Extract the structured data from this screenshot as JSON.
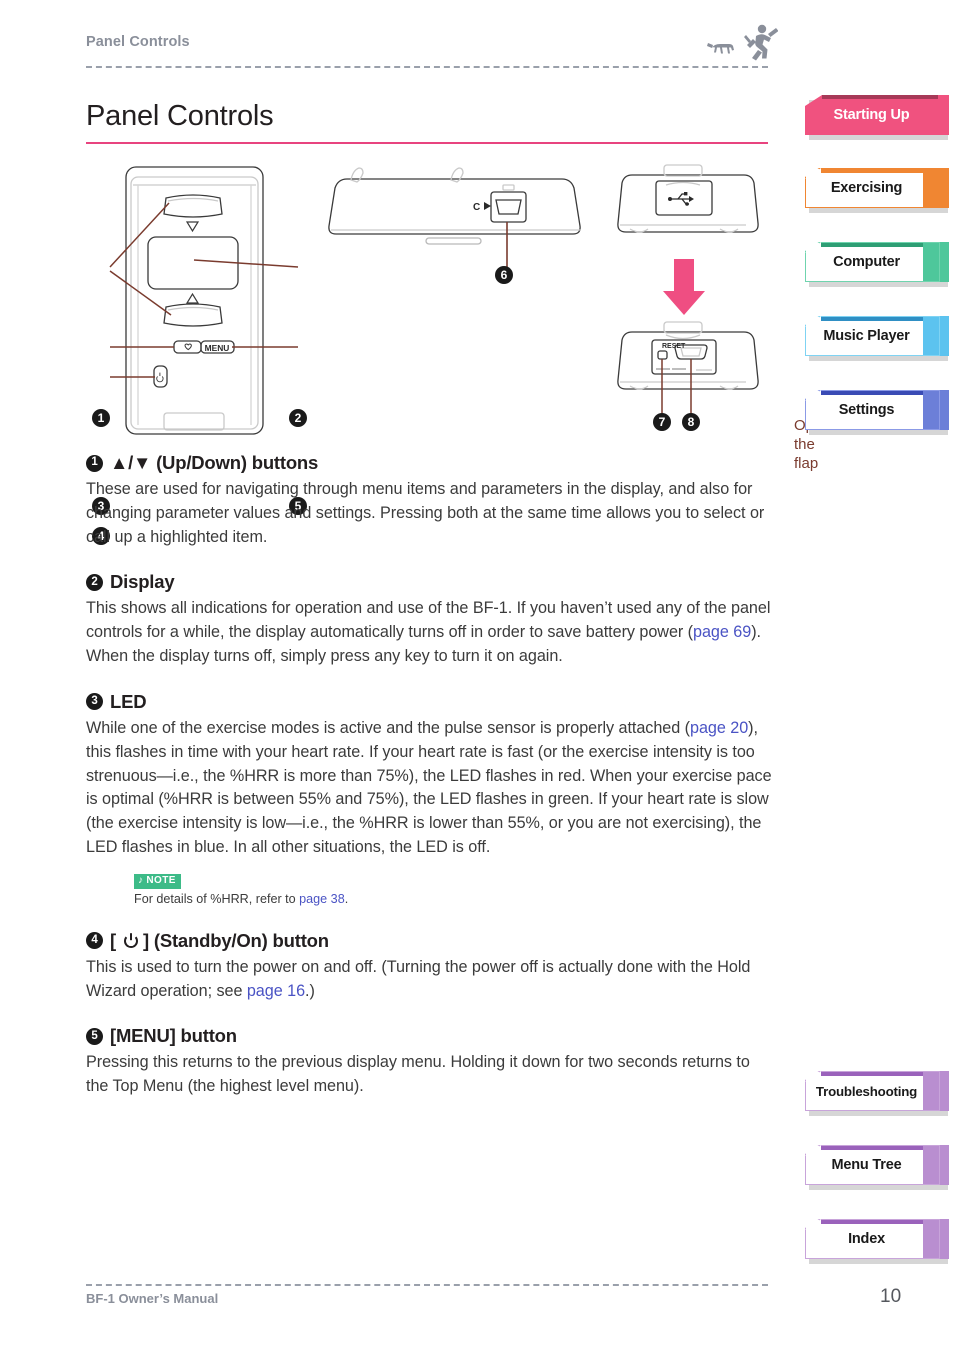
{
  "header": {
    "running_title": "Panel Controls",
    "logo_name": "runner-with-dog-icon"
  },
  "page_title": "Panel Controls",
  "accent_colors": {
    "title_rule": "#e8447f",
    "starting_up": "#f0527f",
    "exercising": "#f08632",
    "computer": "#4ec79b",
    "music_player": "#5cc3ef",
    "settings": "#6c7fd8",
    "purple_tabs": "#b98ed0",
    "note_badge": "#3dbb88",
    "link": "#4a53c4",
    "callout_line": "#7a3b2e"
  },
  "sidebar": {
    "top_tabs": [
      {
        "label": "Starting Up",
        "color": "#f0527f",
        "active": true
      },
      {
        "label": "Exercising",
        "color": "#f08632",
        "active": false
      },
      {
        "label": "Computer",
        "color": "#4ec79b",
        "active": false
      },
      {
        "label": "Music Player",
        "color": "#5cc3ef",
        "active": false
      },
      {
        "label": "Settings",
        "color": "#6c7fd8",
        "active": false
      }
    ],
    "bottom_tabs": [
      {
        "label": "Troubleshooting",
        "color": "#b98ed0",
        "active": false
      },
      {
        "label": "Menu Tree",
        "color": "#b98ed0",
        "active": false
      },
      {
        "label": "Index",
        "color": "#b98ed0",
        "active": false
      }
    ]
  },
  "diagram": {
    "front_view": {
      "callouts": [
        "1",
        "2",
        "3",
        "4",
        "5"
      ],
      "up_arrow_label": "△",
      "down_arrow_label": "▽",
      "heart_label": "♡",
      "menu_label": "MENU"
    },
    "side_view": {
      "callouts": [
        "6"
      ],
      "port_label": "C"
    },
    "rear_view": {
      "usb_icon": "usb-icon",
      "open_flap_line1": "Open",
      "open_flap_line2": "the flap",
      "reset_label": "RESET",
      "callouts": [
        "7",
        "8"
      ]
    }
  },
  "sections": [
    {
      "num": "1",
      "heading": "▲/▼ (Up/Down) buttons",
      "body_parts": [
        {
          "t": "These are used for navigating through menu items and parameters in the display, and also for changing parameter values and settings. Pressing both at the same time allows you to select or call up a highlighted item."
        }
      ]
    },
    {
      "num": "2",
      "heading": "Display",
      "body_parts": [
        {
          "t": "This shows all indications for operation and use of the BF-1. If you haven’t used any of the panel controls for a while, the display automatically turns off in order to save battery power ("
        },
        {
          "t": "page 69",
          "link": true
        },
        {
          "t": "). When the display turns off, simply press any key to turn it on again."
        }
      ]
    },
    {
      "num": "3",
      "heading": "LED",
      "body_parts": [
        {
          "t": "While one of the exercise modes is active and the pulse sensor is properly attached ("
        },
        {
          "t": "page 20",
          "link": true
        },
        {
          "t": "), this flashes in time with your heart rate. If your heart rate is fast (or the exercise intensity is too strenuous—i.e., the %HRR is more than 75%), the LED flashes in red. When your exercise pace is optimal (%HRR is between 55% and 75%), the LED flashes in green. If your heart rate is slow (the exercise intensity is low—i.e., the %HRR is lower than 55%, or you are not exercising), the LED flashes in blue. In all other situations, the LED is off."
        }
      ],
      "note": {
        "badge": "NOTE",
        "badge_icon": "music-note-icon",
        "text_parts": [
          {
            "t": "For details of %HRR, refer to "
          },
          {
            "t": "page 38",
            "link": true
          },
          {
            "t": "."
          }
        ]
      }
    },
    {
      "num": "4",
      "heading_prefix": "[",
      "heading_icon": "power-standby-icon",
      "heading": "] (Standby/On) button",
      "body_parts": [
        {
          "t": "This is used to turn the power on and off. (Turning the power off is actually done with the Hold Wizard operation; see "
        },
        {
          "t": "page 16",
          "link": true
        },
        {
          "t": ".)"
        }
      ]
    },
    {
      "num": "5",
      "heading": "[MENU] button",
      "body_parts": [
        {
          "t": "Pressing this returns to the previous display menu. Holding it down for two seconds returns to the Top Menu (the highest level menu)."
        }
      ]
    }
  ],
  "footer": {
    "left": "BF-1 Owner’s Manual",
    "page_number": "10"
  }
}
